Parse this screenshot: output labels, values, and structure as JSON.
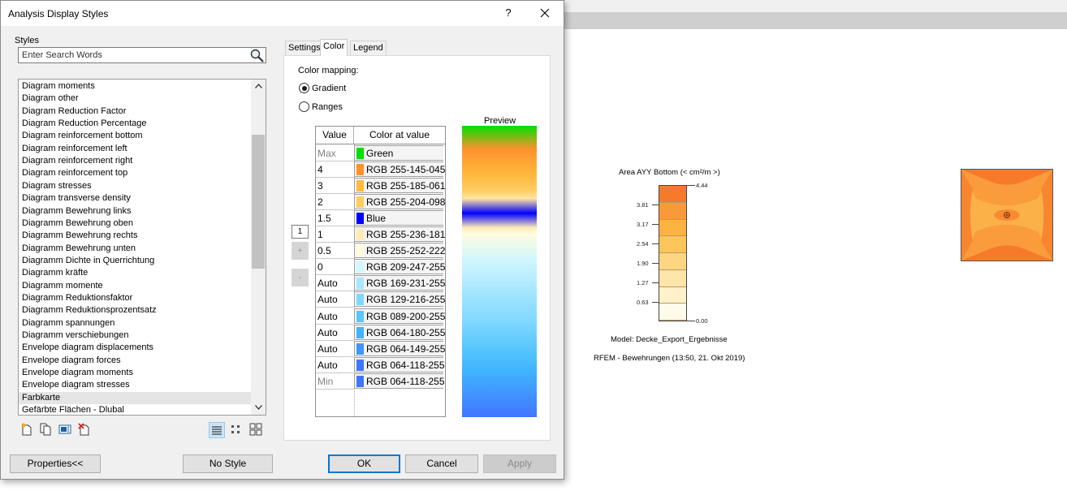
{
  "dialog": {
    "title": "Analysis Display Styles",
    "help_label": "?",
    "close_label": "✕",
    "styles_label": "Styles",
    "search_placeholder": "Enter Search Words",
    "styles": [
      "Diagram moments",
      "Diagram other",
      "Diagram Reduction Factor",
      "Diagram Reduction Percentage",
      "Diagram reinforcement bottom",
      "Diagram reinforcement left",
      "Diagram reinforcement right",
      "Diagram reinforcement top",
      "Diagram stresses",
      "Diagram transverse density",
      "Diagramm Bewehrung links",
      "Diagramm Bewehrung oben",
      "Diagramm Bewehrung rechts",
      "Diagramm Bewehrung unten",
      "Diagramm Dichte in Querrichtung",
      "Diagramm kräfte",
      "Diagramm momente",
      "Diagramm Reduktionsfaktor",
      "Diagramm Reduktionsprozentsatz",
      "Diagramm spannungen",
      "Diagramm verschiebungen",
      "Envelope diagram displacements",
      "Envelope diagram forces",
      "Envelope diagram moments",
      "Envelope diagram stresses",
      "Farbkarte",
      "Gefärbte Flächen - Dlubal"
    ],
    "selected_style": "Farbkarte",
    "tabs": [
      "Settings",
      "Color",
      "Legend"
    ],
    "active_tab": "Color",
    "color_tab": {
      "color_mapping_label": "Color mapping:",
      "gradient_label": "Gradient",
      "ranges_label": "Ranges",
      "mode": "Gradient",
      "col_value": "Value",
      "col_color": "Color at value",
      "rows": [
        {
          "value": "Max",
          "color_name": "Green",
          "hex": "#00e000",
          "muted": true
        },
        {
          "value": "4",
          "color_name": "RGB 255-145-045",
          "hex": "#ff912d",
          "muted": false
        },
        {
          "value": "3",
          "color_name": "RGB 255-185-061",
          "hex": "#ffb93d",
          "muted": false
        },
        {
          "value": "2",
          "color_name": "RGB 255-204-098",
          "hex": "#ffcc62",
          "muted": false
        },
        {
          "value": "1.5",
          "color_name": "Blue",
          "hex": "#0000ff",
          "muted": false
        },
        {
          "value": "1",
          "color_name": "RGB 255-236-181",
          "hex": "#ffecb5",
          "muted": false
        },
        {
          "value": "0.5",
          "color_name": "RGB 255-252-222",
          "hex": "#fffcde",
          "muted": false
        },
        {
          "value": "0",
          "color_name": "RGB 209-247-255",
          "hex": "#d1f7ff",
          "muted": false
        },
        {
          "value": "Auto",
          "color_name": "RGB 169-231-255",
          "hex": "#a9e7ff",
          "muted": false
        },
        {
          "value": "Auto",
          "color_name": "RGB 129-216-255",
          "hex": "#81d8ff",
          "muted": false
        },
        {
          "value": "Auto",
          "color_name": "RGB 089-200-255",
          "hex": "#59c8ff",
          "muted": false
        },
        {
          "value": "Auto",
          "color_name": "RGB 064-180-255",
          "hex": "#40b4ff",
          "muted": false
        },
        {
          "value": "Auto",
          "color_name": "RGB 064-149-255",
          "hex": "#4095ff",
          "muted": false
        },
        {
          "value": "Auto",
          "color_name": "RGB 064-118-255",
          "hex": "#4076ff",
          "muted": false
        },
        {
          "value": "Min",
          "color_name": "RGB 064-118-255",
          "hex": "#4076ff",
          "muted": true
        }
      ],
      "count_value": "1",
      "add_label": "+",
      "remove_label": "-",
      "preview_label": "Preview"
    },
    "buttons": {
      "properties": "Properties<<",
      "no_style": "No Style",
      "ok": "OK",
      "cancel": "Cancel",
      "apply": "Apply"
    }
  },
  "chart": {
    "title": "Area AYY Bottom (< cm²/m >)",
    "max_label": "4.44",
    "min_label": "0.00",
    "tick_labels": [
      "3.81",
      "3.17",
      "2.54",
      "1.90",
      "1.27",
      "0.63"
    ],
    "scale_colors": [
      "#f77a2a",
      "#f99a3a",
      "#fcb441",
      "#fdc65a",
      "#fed682",
      "#fee5a8",
      "#fff1c9",
      "#fffbea"
    ],
    "model": "Model: Decke_Export_Ergebnisse",
    "source": "RFEM - Bewehrungen (13:50, 21. Okt 2019)"
  }
}
